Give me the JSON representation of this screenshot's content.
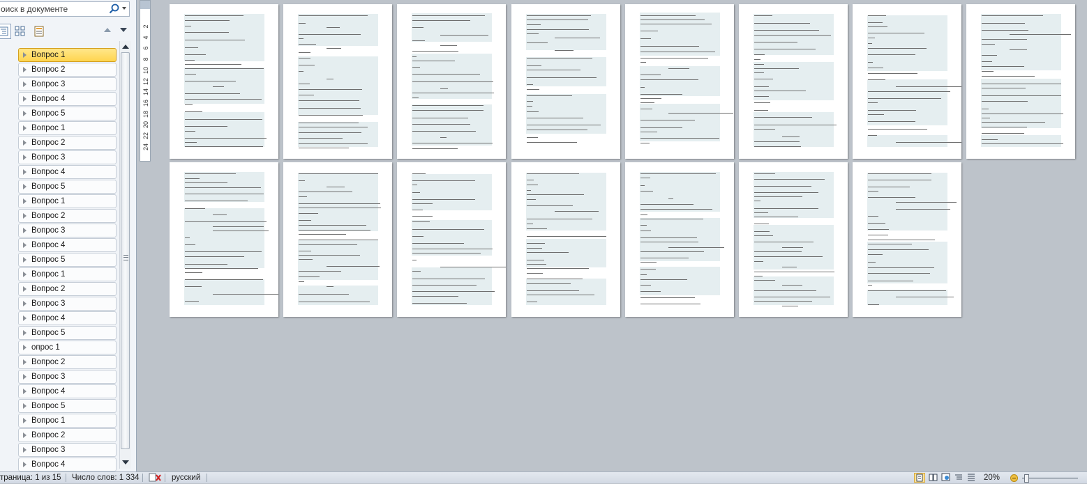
{
  "nav": {
    "search_placeholder": "оиск в документе",
    "headings": [
      {
        "label": "Вопрос 1",
        "selected": true
      },
      {
        "label": "Вопрос 2"
      },
      {
        "label": "Вопрос 3"
      },
      {
        "label": "Вопрос 4"
      },
      {
        "label": "Вопрос 5"
      },
      {
        "label": "Вопрос 1"
      },
      {
        "label": "Вопрос 2"
      },
      {
        "label": "Вопрос 3"
      },
      {
        "label": "Вопрос 4"
      },
      {
        "label": "Вопрос 5"
      },
      {
        "label": "Вопрос 1"
      },
      {
        "label": "Вопрос 2"
      },
      {
        "label": "Вопрос 3"
      },
      {
        "label": "Вопрос 4"
      },
      {
        "label": "Вопрос 5"
      },
      {
        "label": "Вопрос 1"
      },
      {
        "label": "Вопрос 2"
      },
      {
        "label": "Вопрос 3"
      },
      {
        "label": "Вопрос 4"
      },
      {
        "label": "Вопрос 5"
      },
      {
        "label": "опрос 1"
      },
      {
        "label": "Вопрос 2"
      },
      {
        "label": "Вопрос 3"
      },
      {
        "label": "Вопрос 4"
      },
      {
        "label": "Вопрос 5"
      },
      {
        "label": "Вопрос 1"
      },
      {
        "label": "Вопрос 2"
      },
      {
        "label": "Вопрос 3"
      },
      {
        "label": "Вопрос 4"
      }
    ]
  },
  "ruler": {
    "labels": [
      "2",
      "4",
      "6",
      "8",
      "10",
      "12",
      "14",
      "16",
      "18",
      "20",
      "22",
      "24"
    ]
  },
  "document": {
    "page_count": 15
  },
  "status": {
    "page": "траница: 1 из 15",
    "words": "Число слов: 1 334",
    "language": "русский",
    "zoom": "20%"
  },
  "icons": {
    "search": "magnifier-icon",
    "proofing": "spellcheck-error-icon",
    "view_print": "print-layout-icon",
    "view_fullscreen": "full-screen-reading-icon",
    "view_web": "web-layout-icon",
    "view_outline": "outline-icon",
    "view_draft": "draft-icon"
  }
}
